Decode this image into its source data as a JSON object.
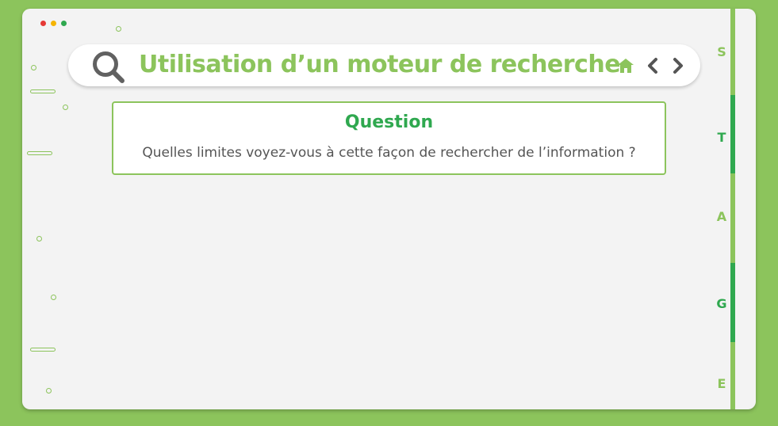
{
  "window": {
    "controls": [
      "close",
      "minimize",
      "maximize"
    ]
  },
  "searchbar": {
    "title": "Utilisation d’un moteur de recherche",
    "icons": [
      "search-icon",
      "home-icon",
      "chevron-left-icon",
      "chevron-right-icon"
    ]
  },
  "question": {
    "heading": "Question",
    "text": "Quelles limites voyez-vous à cette façon de rechercher de l’information ?"
  },
  "stages": {
    "items": [
      {
        "letter": "S",
        "active": false
      },
      {
        "letter": "T",
        "active": true
      },
      {
        "letter": "A",
        "active": false
      },
      {
        "letter": "G",
        "active": true
      },
      {
        "letter": "E",
        "active": false
      }
    ]
  },
  "colors": {
    "background": "#8cc45c",
    "accent_light": "#8cc45c",
    "accent_dark": "#2fa84f",
    "window": "#f3f3f3",
    "text": "#555555"
  }
}
